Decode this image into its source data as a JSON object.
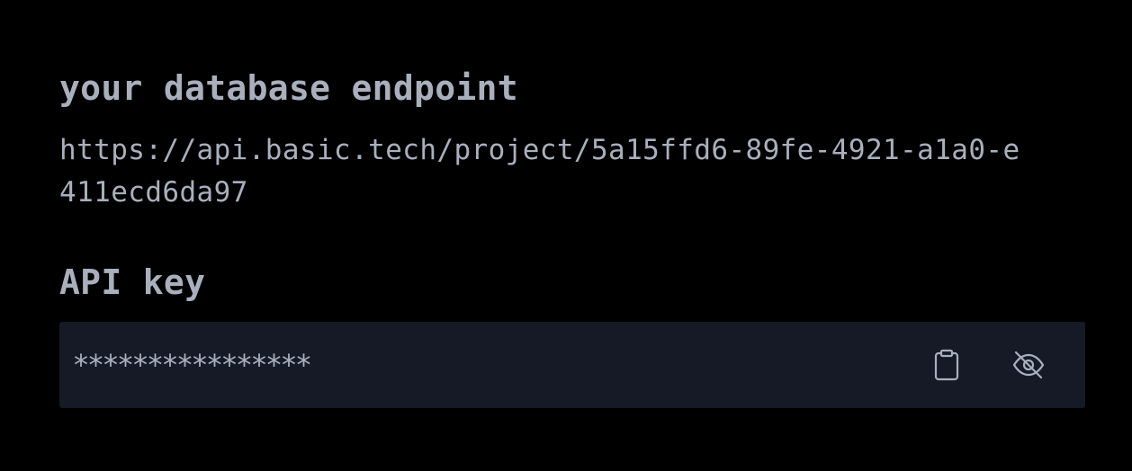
{
  "endpoint": {
    "heading": "your database endpoint",
    "url": "https://api.basic.tech/project/5a15ffd6-89fe-4921-a1a0-e411ecd6da97"
  },
  "api_key": {
    "heading": "API key",
    "masked_value": "****************",
    "icons": {
      "copy": "clipboard-icon",
      "visibility": "eye-off-icon"
    }
  },
  "colors": {
    "background": "#000000",
    "text": "#a9afbc",
    "key_box": "#151a26"
  }
}
